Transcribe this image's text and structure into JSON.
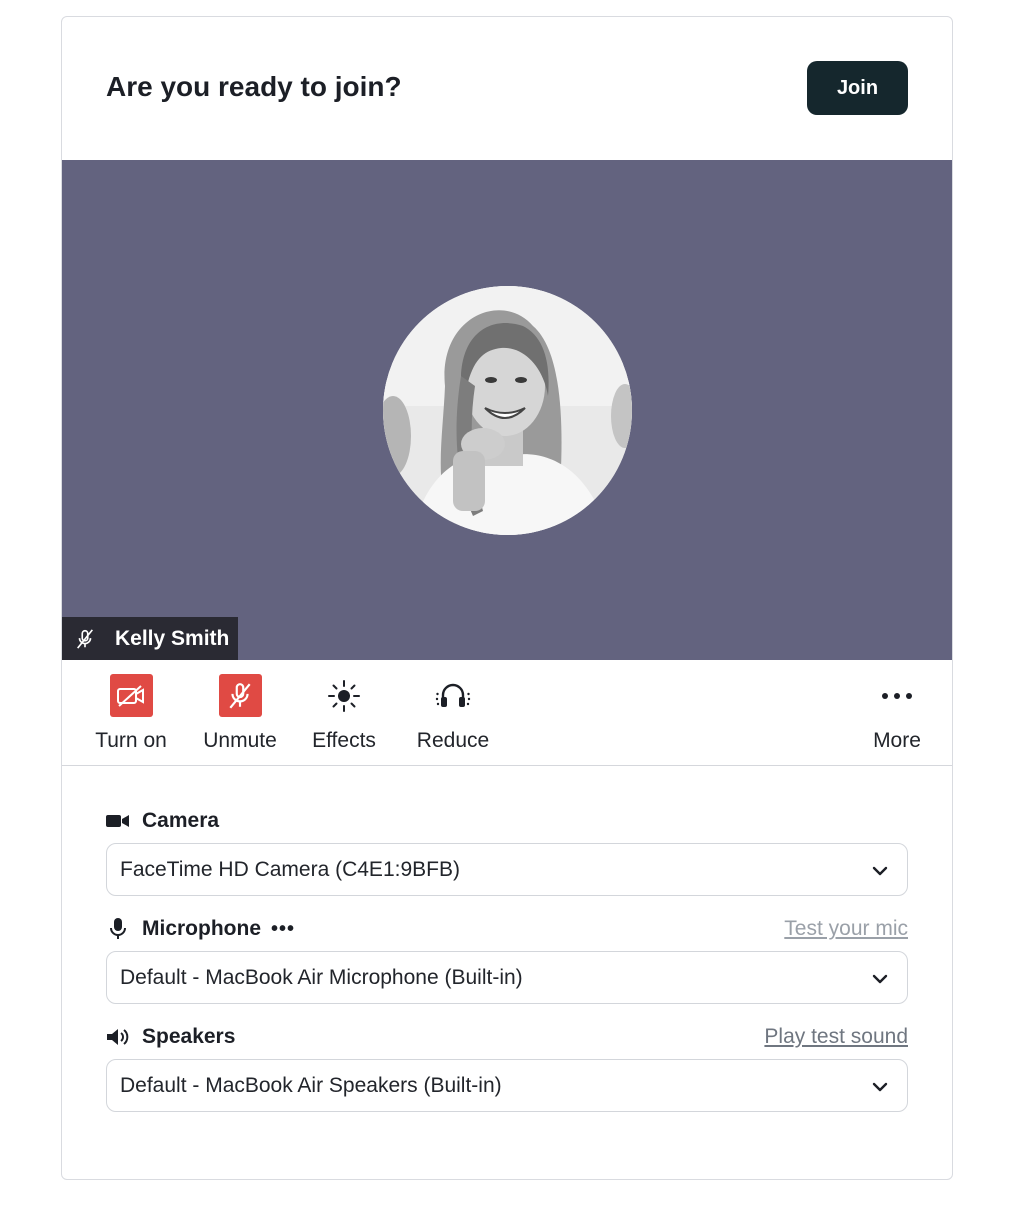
{
  "header": {
    "title": "Are you ready to join?",
    "join_label": "Join"
  },
  "video": {
    "participant_name": "Kelly Smith",
    "background": "#63637f"
  },
  "controls": {
    "camera_label": "Turn on",
    "mic_label": "Unmute",
    "effects_label": "Effects",
    "reduce_label": "Reduce",
    "more_label": "More",
    "more_icon": "•••"
  },
  "settings": {
    "camera": {
      "title": "Camera",
      "value": "FaceTime HD Camera (C4E1:9BFB)"
    },
    "microphone": {
      "title": "Microphone",
      "dots": "•••",
      "link": "Test your mic",
      "value": "Default - MacBook Air Microphone (Built-in)"
    },
    "speakers": {
      "title": "Speakers",
      "link": "Play test sound",
      "value": "Default - MacBook Air Speakers (Built-in)"
    }
  },
  "colors": {
    "accent_dark": "#15272d",
    "danger": "#e04a44",
    "video_bg": "#63637f"
  },
  "icons": [
    "camera-off-icon",
    "mic-off-icon",
    "effects-icon",
    "headphones-icon",
    "more-icon",
    "video-camera-icon",
    "microphone-icon",
    "speaker-icon",
    "chevron-down-icon"
  ]
}
